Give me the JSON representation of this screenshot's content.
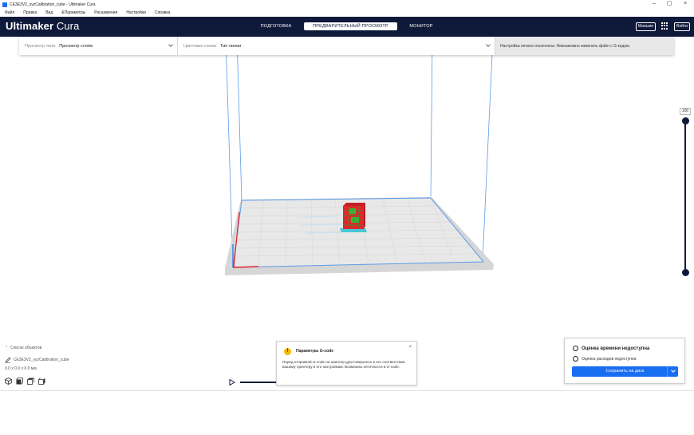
{
  "window": {
    "title": "CE3E3V2_xyzCalibration_cube - Ultimaker Cura",
    "minimize": "–",
    "maximize": "▢",
    "close": "×"
  },
  "menubar": [
    "Файл",
    "Правка",
    "Вид",
    "&Параметры",
    "Расширения",
    "Настройки",
    "Справка"
  ],
  "header": {
    "logo_brand": "Ultimaker",
    "logo_product": " Cura",
    "tabs": [
      {
        "label": "ПОДГОТОВКА",
        "active": false
      },
      {
        "label": "ПРЕДВАРИТЕЛЬНЫЙ ПРОСМОТР",
        "active": true
      },
      {
        "label": "МОНИТОР",
        "active": false
      }
    ],
    "marketplace_label": "Магазин",
    "signin_label": "Войти"
  },
  "viewbar": {
    "view_type_label": "Просмотр типа",
    "view_type_value": "Просмотр слоёв",
    "color_scheme_label": "Цветовая схема",
    "color_scheme_value": "Тип линии",
    "message": "Настройка печати отключена. Невозможно изменить файл с G-кодом."
  },
  "layer_slider": {
    "value": "100",
    "min": 0,
    "max": 100
  },
  "object_list": {
    "toggle_label": "Список объектов",
    "file_name": "CE3E3V2_xyzCalibration_cube",
    "dimensions": "0.0 x 0.0 x 0.0 мм"
  },
  "toast": {
    "icon": "!",
    "title": "Параметры G-code",
    "body": "Перед отправкой G-code на принтер удостоверьтесь в его соответствии вашему принтеру и его настройкам. Возможны неточности в G-code.",
    "close": "×"
  },
  "print_panel": {
    "time_estimate": "Оценка времени недоступна",
    "cost_estimate": "Оценка расходов недоступна",
    "save_label": "Сохранить на диск"
  },
  "colors": {
    "header_bg": "#0f1a3a",
    "accent": "#196ef0",
    "warning": "#f3ba00",
    "model_red": "#e3242b",
    "model_green": "#36b336"
  }
}
